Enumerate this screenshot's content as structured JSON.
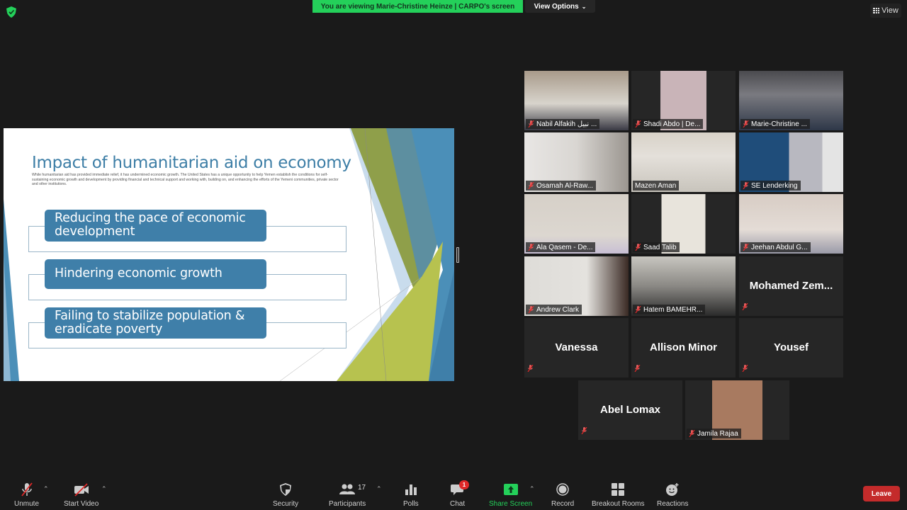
{
  "top_bar": {
    "banner_text": "You are viewing Marie-Christine Heinze | CARPO's screen",
    "view_options_label": "View Options",
    "view_label": "View",
    "colors": {
      "banner": "#24d05a",
      "security_shield": "#24d05a"
    }
  },
  "slide": {
    "title": "Impact of humanitarian aid on economy",
    "subtitle": "While humanitarian aid has provided immediate relief, it has undermined economic growth. The United States has a unique opportunity to help Yemen establish the conditions for self-sustaining economic growth and development by providing financial and technical support and working with, building on, and enhancing the efforts of the Yemeni communities, private sector and other institutions.",
    "points": [
      "Reducing the pace of economic development",
      "Hindering economic growth",
      "Failing to stabilize population & eradicate poverty"
    ],
    "colors": {
      "title": "#3d7ea6",
      "pill": "#3f7fa9",
      "accent_green": "#9cad4a",
      "accent_blue": "#4b8fb8"
    }
  },
  "participants": [
    {
      "name": "Nabil Alfakih نبيل ...",
      "video": true,
      "muted": true
    },
    {
      "name": "Shadi Abdo | De...",
      "video": true,
      "muted": true
    },
    {
      "name": "Marie-Christine ...",
      "video": true,
      "muted": true
    },
    {
      "name": "Osamah Al-Raw...",
      "video": true,
      "muted": true
    },
    {
      "name": "Mazen Aman",
      "video": true,
      "muted": false,
      "active_speaker": true
    },
    {
      "name": "SE Lenderking",
      "video": true,
      "muted": true
    },
    {
      "name": "Ala Qasem - De...",
      "video": true,
      "muted": true
    },
    {
      "name": "Saad Talib",
      "video": true,
      "muted": true
    },
    {
      "name": "Jeehan Abdul G...",
      "video": true,
      "muted": true
    },
    {
      "name": "Andrew Clark",
      "video": true,
      "muted": true
    },
    {
      "name": "Hatem BAMEHR...",
      "video": true,
      "muted": true
    },
    {
      "name": "Mohamed  Zem...",
      "video": false,
      "muted": true
    },
    {
      "name": "Vanessa",
      "video": false,
      "muted": true
    },
    {
      "name": "Allison Minor",
      "video": false,
      "muted": true
    },
    {
      "name": "Yousef",
      "video": false,
      "muted": true
    },
    {
      "name": "Abel Lomax",
      "video": false,
      "muted": true
    },
    {
      "name": "Jamila Rajaa",
      "video": true,
      "muted": true
    }
  ],
  "toolbar": {
    "unmute": "Unmute",
    "start_video": "Start Video",
    "security": "Security",
    "participants": "Participants",
    "participant_count": "17",
    "polls": "Polls",
    "chat": "Chat",
    "chat_badge": "1",
    "share_screen": "Share Screen",
    "record": "Record",
    "breakout_rooms": "Breakout Rooms",
    "reactions": "Reactions",
    "leave": "Leave",
    "colors": {
      "share": "#24d05a",
      "leave": "#c42b2b",
      "badge": "#e02828"
    }
  }
}
